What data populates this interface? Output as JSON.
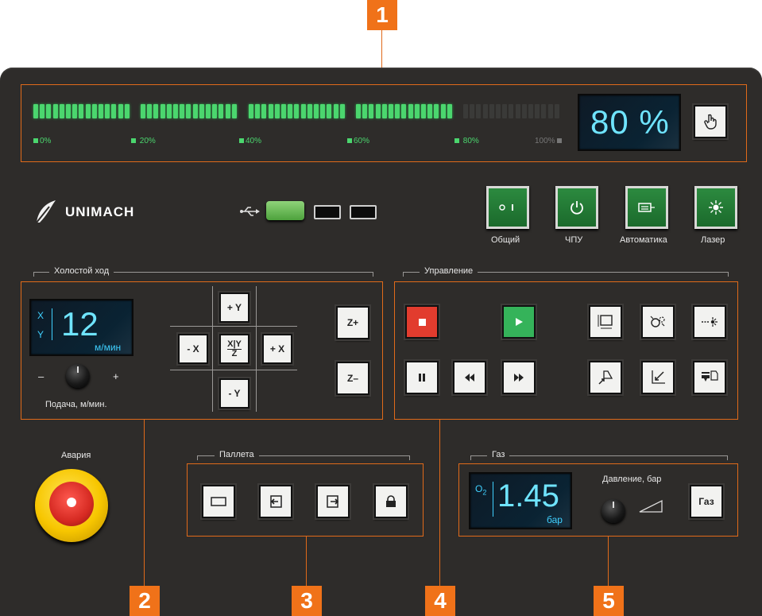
{
  "callouts": [
    "1",
    "2",
    "3",
    "4",
    "5"
  ],
  "brand": {
    "name": "UNIMACH"
  },
  "power_meter": {
    "ticks": [
      "0%",
      "20%",
      "40%",
      "60%",
      "80%",
      "100%"
    ],
    "value_text": "80 %",
    "level": 0.8,
    "button_icon": "hand-pointer-icon"
  },
  "usb": {
    "icon": "usb-icon"
  },
  "switches": [
    {
      "label": "Общий",
      "icon": "toggle-switch-icon"
    },
    {
      "label": "ЧПУ",
      "icon": "power-icon"
    },
    {
      "label": "Автоматика",
      "icon": "automation-icon"
    },
    {
      "label": "Лазер",
      "icon": "laser-icon"
    }
  ],
  "idle": {
    "title": "Холостой ход",
    "axis_x": "X",
    "axis_y": "Y",
    "speed_value": "12",
    "speed_unit": "м/мин",
    "minus": "–",
    "plus": "+",
    "feed_label": "Подача, м/мин.",
    "buttons": {
      "plus_y": "+ Y",
      "minus_y": "- Y",
      "minus_x": "- X",
      "plus_x": "+ X",
      "xy_top": "X|Y",
      "xy_bottom": "Z",
      "z_plus": "Z+",
      "z_minus": "Z–"
    }
  },
  "control": {
    "title": "Управление"
  },
  "emergency": {
    "label": "Авария"
  },
  "pallet": {
    "title": "Паллета"
  },
  "gas": {
    "title": "Газ",
    "gas_symbol": "O",
    "gas_subscript": "2",
    "pressure_value": "1.45",
    "pressure_unit": "бар",
    "pressure_label": "Давление, бар",
    "button": "Газ"
  },
  "colors": {
    "accent": "#f07219",
    "lcd_text": "#3fd0ff",
    "meter_on": "#4bd66e"
  }
}
